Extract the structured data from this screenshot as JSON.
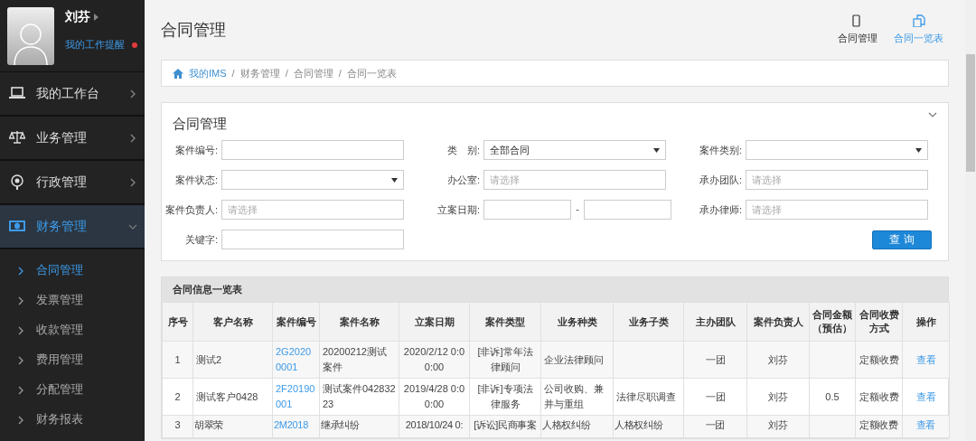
{
  "user": {
    "name": "刘芬",
    "reminder": "我的工作提醒"
  },
  "nav": [
    {
      "label": "我的工作台",
      "selected": false,
      "expanded": false
    },
    {
      "label": "业务管理",
      "selected": false,
      "expanded": false
    },
    {
      "label": "行政管理",
      "selected": false,
      "expanded": false
    },
    {
      "label": "财务管理",
      "selected": true,
      "expanded": true,
      "children": [
        {
          "label": "合同管理",
          "selected": true
        },
        {
          "label": "发票管理",
          "selected": false
        },
        {
          "label": "收款管理",
          "selected": false
        },
        {
          "label": "费用管理",
          "selected": false
        },
        {
          "label": "分配管理",
          "selected": false
        },
        {
          "label": "财务报表",
          "selected": false
        }
      ]
    }
  ],
  "header": {
    "title": "合同管理",
    "actions": [
      {
        "label": "合同管理",
        "selected": false
      },
      {
        "label": "合同一览表",
        "selected": true
      }
    ]
  },
  "breadcrumb": [
    {
      "label": "我的IMS"
    },
    {
      "separator": "/",
      "label": "财务管理"
    },
    {
      "separator": "/",
      "label": "合同管理"
    },
    {
      "separator": "/",
      "label": "合同一览表"
    }
  ],
  "search_panel": {
    "title": "合同管理",
    "fields": [
      {
        "label": "案件编号:",
        "kind": "text"
      },
      {
        "label": "类　别:",
        "kind": "select",
        "value": "全部合同"
      },
      {
        "label": "案件类别:",
        "kind": "select"
      },
      {
        "label": "案件状态:",
        "kind": "select"
      },
      {
        "label": "办公室:",
        "kind": "text",
        "placeholder": "请选择"
      },
      {
        "label": "承办团队:",
        "kind": "text",
        "placeholder": "请选择"
      },
      {
        "label": "案件负责人:",
        "kind": "text",
        "placeholder": "请选择"
      },
      {
        "label": "立案日期:",
        "kind": "daterange",
        "separator": "-"
      },
      {
        "label": "承办律师:",
        "kind": "text",
        "placeholder": "请选择"
      },
      {
        "label": "关键字:",
        "kind": "text"
      }
    ],
    "button": "查 询"
  },
  "table": {
    "title": "合同信息一览表",
    "columns": [
      {
        "label": "序号",
        "kind": "num"
      },
      {
        "label": "客户名称",
        "kind": "text"
      },
      {
        "label": "案件编号",
        "kind": "link"
      },
      {
        "label": "案件名称",
        "kind": "text"
      },
      {
        "label": "立案日期",
        "kind": "center"
      },
      {
        "label": "案件类型",
        "kind": "center"
      },
      {
        "label": "业务种类",
        "kind": "text"
      },
      {
        "label": "业务子类",
        "kind": "text"
      },
      {
        "label": "主办团队",
        "kind": "center"
      },
      {
        "label": "案件负责人",
        "kind": "center"
      },
      {
        "label": "合同金额（预估）",
        "kind": "center"
      },
      {
        "label": "合同收费方式",
        "kind": "center"
      },
      {
        "label": "操作",
        "kind": "link"
      }
    ],
    "rows": [
      [
        "1",
        "测试2",
        "2G20200001",
        "20200212测试案件",
        "2020/2/12 0:00:00",
        "[非诉]常年法律顾问",
        "企业法律顾问",
        "",
        "一团",
        "刘芬",
        "",
        "定额收费",
        "查看"
      ],
      [
        "2",
        "测试客户0428",
        "2F20190001",
        "测试案件04283223",
        "2019/4/28 0:00:00",
        "[非诉]专项法律服务",
        "公司收购、兼并与重组",
        "法律尽职调查",
        "一团",
        "刘芬",
        "0.5",
        "定额收费",
        "查看"
      ],
      [
        "3",
        "胡翠荣",
        "2M2018",
        "继承纠纷",
        "2018/10/24 0:",
        "[诉讼]民商事案",
        "人格权纠纷",
        "人格权纠纷",
        "一团",
        "刘芬",
        "",
        "定额收费",
        "查看"
      ]
    ]
  }
}
